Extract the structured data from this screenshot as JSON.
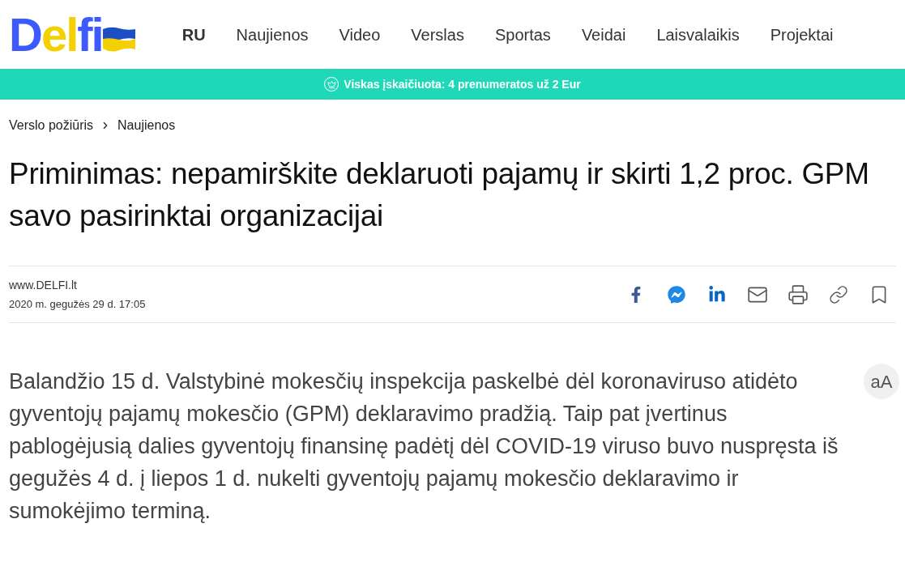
{
  "logo": {
    "parts": [
      {
        "text": "D",
        "color": "#3d5afe"
      },
      {
        "text": "el",
        "color": "#f5d000"
      },
      {
        "text": "fi",
        "color": "#3d5afe"
      }
    ]
  },
  "nav": [
    {
      "label": "RU",
      "kind": "lang"
    },
    {
      "label": "Naujienos",
      "kind": "section"
    },
    {
      "label": "Video",
      "kind": "section"
    },
    {
      "label": "Verslas",
      "kind": "section"
    },
    {
      "label": "Sportas",
      "kind": "section"
    },
    {
      "label": "Veidai",
      "kind": "section"
    },
    {
      "label": "Laisvalaikis",
      "kind": "section"
    },
    {
      "label": "Projektai",
      "kind": "section"
    }
  ],
  "promo_bar": {
    "text": "Viskas įskaičiuota: 4 prenumeratos už 2 Eur"
  },
  "breadcrumbs": [
    "Verslo požiūris",
    "Naujienos"
  ],
  "article": {
    "title": "Priminimas: nepamirškite deklaruoti pajamų ir skirti 1,2 proc. GPM savo pasirinktai organizacijai",
    "source": "www.DELFI.lt",
    "date": "2020 m. gegužės 29 d. 17:05",
    "share": [
      {
        "kind": "facebook"
      },
      {
        "kind": "messenger"
      },
      {
        "kind": "linkedin"
      },
      {
        "kind": "email"
      },
      {
        "kind": "print"
      },
      {
        "kind": "link"
      },
      {
        "kind": "bookmark"
      }
    ],
    "font_size_button": "aA",
    "body": "Balandžio 15 d. Valstybinė mokesčių inspekcija paskelbė dėl koronaviruso atidėto gyventojų pajamų mokesčio (GPM) deklaravimo pradžią. Taip pat įvertinus pablogėjusią dalies gyventojų finansinę padėtį dėl COVID-19 viruso buvo nuspręsta iš gegužės 4 d. į liepos 1 d. nukelti gyventojų pajamų mokesčio deklaravimo ir sumokėjimo terminą."
  }
}
